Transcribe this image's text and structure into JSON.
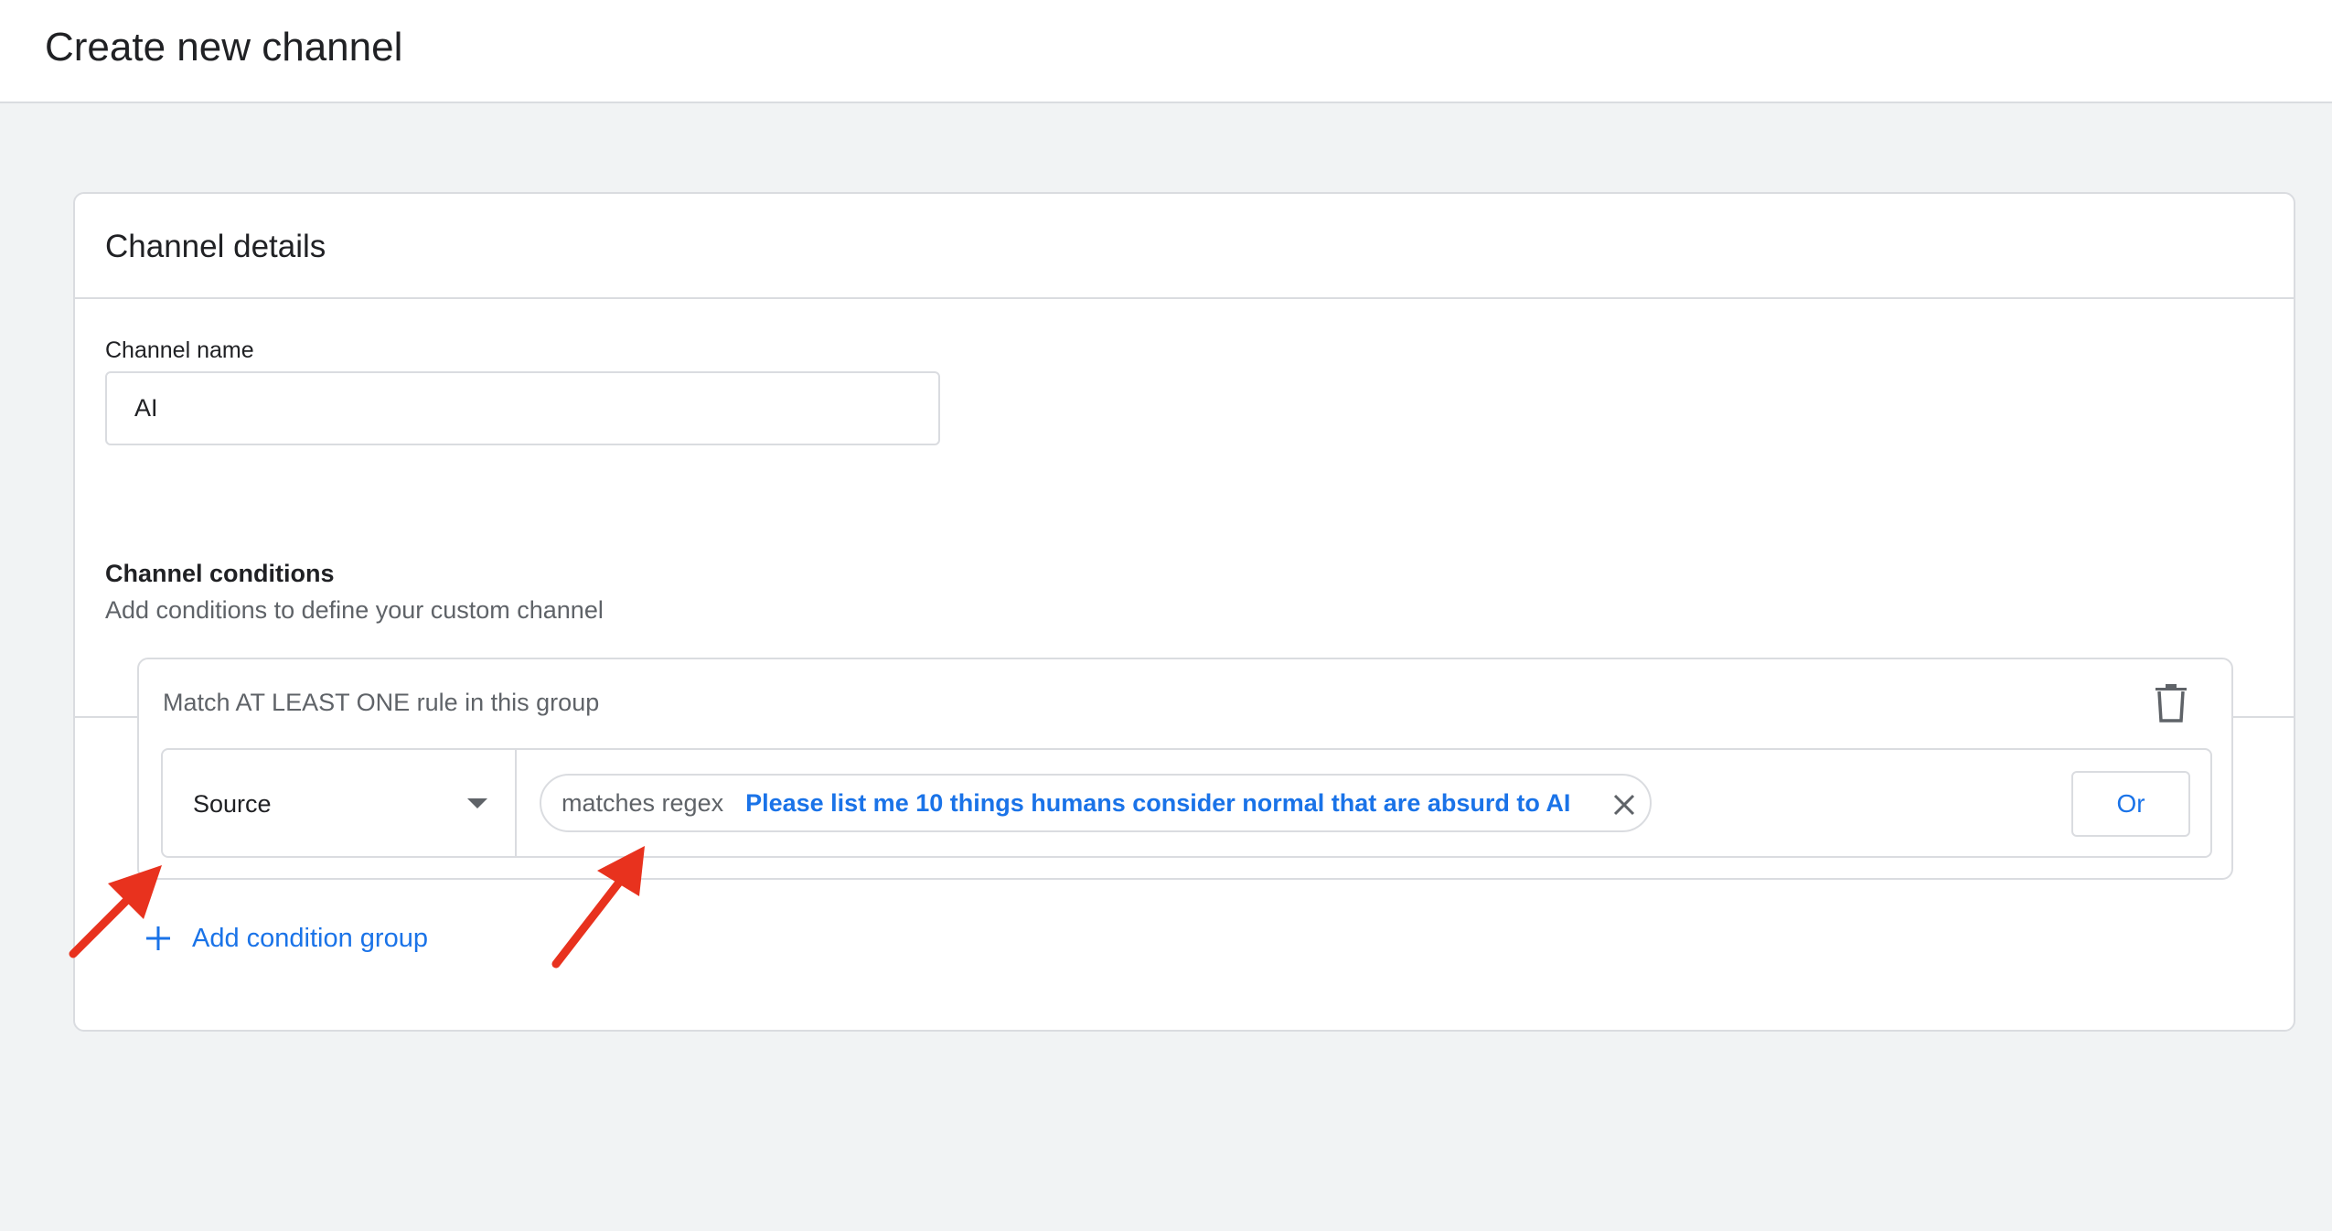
{
  "header": {
    "title": "Create new channel"
  },
  "card": {
    "title": "Channel details",
    "channel_name": {
      "label": "Channel name",
      "value": "AI"
    },
    "conditions": {
      "title": "Channel conditions",
      "subtitle": "Add conditions to define your custom channel",
      "group": {
        "label": "Match AT LEAST ONE rule in this group",
        "rule": {
          "dimension": "Source",
          "operator": "matches regex",
          "value": "Please list me 10 things humans consider normal that are absurd to AI",
          "or_label": "Or"
        }
      },
      "add_group_label": "Add condition group"
    }
  },
  "colors": {
    "accent": "#1a73e8",
    "annotation_arrow": "#e8321e"
  },
  "icons": [
    "trash-icon",
    "dropdown-arrow-icon",
    "close-icon",
    "plus-icon",
    "annotation-arrow-icon"
  ]
}
